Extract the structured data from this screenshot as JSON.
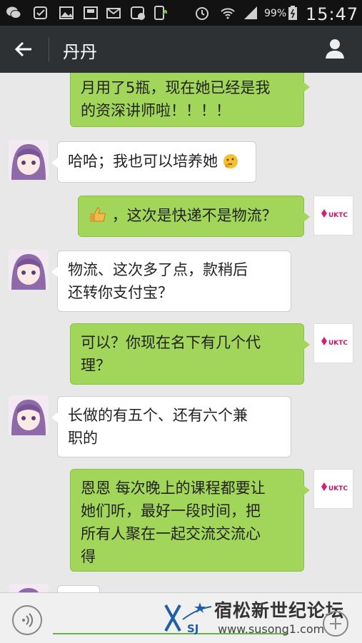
{
  "status_bar": {
    "battery_percent": "99%",
    "time": "15:47"
  },
  "header": {
    "title": "丹丹"
  },
  "messages": [
    {
      "side": "right",
      "text": "月用了5瓶，现在她已经是我\n的资深讲师啦！！！！"
    },
    {
      "side": "left",
      "text": "哈哈；我也可以培养她"
    },
    {
      "side": "right",
      "text": "，这次是快递不是物流？"
    },
    {
      "side": "left",
      "text": "物流、这次多了点，款稍后\n还转你支付宝？"
    },
    {
      "side": "right",
      "text": "可以？你现在名下有几个代\n理？"
    },
    {
      "side": "left",
      "text": "长做的有五个、还有六个兼\n职的"
    },
    {
      "side": "right",
      "text": "恩恩 每次晚上的课程都要让\n她们听，最好一段时间，把\n所有人聚在一起交流交流心\n得"
    }
  ],
  "watermark": {
    "cn": "宿松新世纪论坛",
    "url": "www.susong1.com",
    "logo_text": "SJ"
  },
  "icons": {
    "back": "arrow-left-icon",
    "profile": "person-icon",
    "voice": "voice-icon",
    "plus": "plus-icon"
  },
  "colors": {
    "green_bubble": "#a2d65b",
    "topbar": "#2e3134"
  }
}
